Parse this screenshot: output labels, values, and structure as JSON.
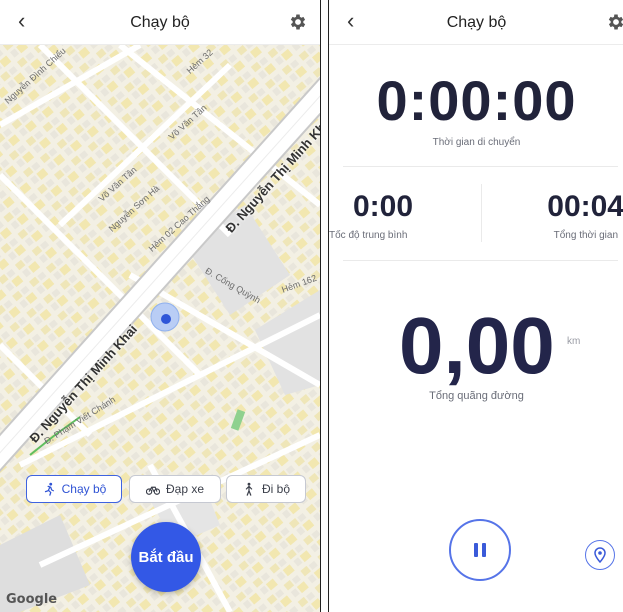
{
  "left_screen": {
    "header": {
      "title": "Chạy bộ",
      "back_icon": "chevron-left-icon",
      "settings_icon": "gear-icon"
    },
    "map": {
      "street_labels": [
        "Nguyễn Đình Chiểu",
        "Hẻm 32",
        "Võ Văn Tần",
        "Võ Văn Tần",
        "Nguyễn Sơn Hà",
        "Hẻm 02 Cao Thắng",
        "Đ. Cống Quỳnh",
        "Hẻm 162",
        "Đ. Phạm Viết Chánh"
      ],
      "main_roads": [
        "Đ. Nguyễn Thị Minh Khai",
        "Đ. Nguyễn Thị Minh Khai"
      ],
      "attribution": "Google"
    },
    "modes": [
      {
        "label": "Chạy bộ",
        "icon": "running-icon",
        "selected": true
      },
      {
        "label": "Đạp xe",
        "icon": "bicycle-icon",
        "selected": false
      },
      {
        "label": "Đi bộ",
        "icon": "walking-icon",
        "selected": false
      }
    ],
    "start_button": "Bắt đầu"
  },
  "right_screen": {
    "header": {
      "title": "Chạy bộ",
      "back_icon": "chevron-left-icon",
      "settings_icon": "gear-icon"
    },
    "moving_time": {
      "value": "0:00:00",
      "label": "Thời gian di chuyển"
    },
    "avg_speed": {
      "value": "0:00",
      "label": "Tốc độ trung bình"
    },
    "total_time": {
      "value": "00:04",
      "label": "Tổng thời gian"
    },
    "distance": {
      "value": "0,00",
      "unit": "km",
      "label": "Tổng quãng đường"
    },
    "controls": {
      "pause_icon": "pause-icon",
      "location_icon": "location-pin-icon"
    },
    "accent_color": "#3358e6"
  }
}
